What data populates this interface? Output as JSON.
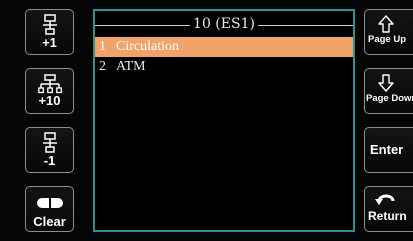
{
  "left_buttons": [
    {
      "label": "+1",
      "icon": "tree-add-one-icon"
    },
    {
      "label": "+10",
      "icon": "tree-add-ten-icon"
    },
    {
      "label": "-1",
      "icon": "tree-minus-one-icon"
    },
    {
      "label": "Clear",
      "icon": "clear-icon"
    }
  ],
  "screen": {
    "title": "10 (ES1)",
    "items": [
      {
        "number": "1",
        "label": "Circulation",
        "selected": true
      },
      {
        "number": "2",
        "label": "ATM",
        "selected": false
      }
    ],
    "border_color": "#2f8f93",
    "highlight_color": "#f2a36a"
  },
  "right_buttons": [
    {
      "label": "Page Up",
      "icon": "arrow-up-icon"
    },
    {
      "label": "Page Down",
      "icon": "arrow-down-icon"
    },
    {
      "label": "Enter",
      "icon": ""
    },
    {
      "label": "Return",
      "icon": "return-icon"
    }
  ]
}
